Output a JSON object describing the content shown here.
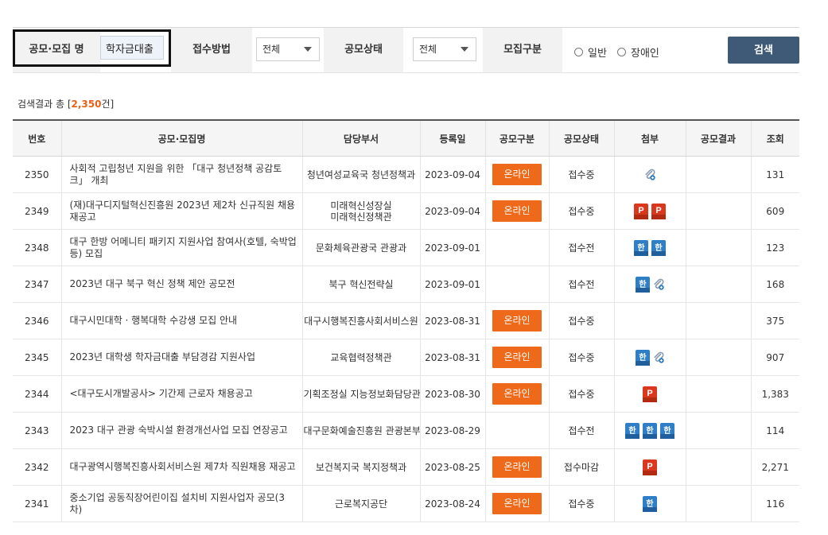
{
  "filter": {
    "title_label": "공모·모집 명",
    "title_value": "학자금대출",
    "method_label": "접수방법",
    "method_value": "전체",
    "status_label": "공모상태",
    "status_value": "전체",
    "category_label": "모집구분",
    "radio_general": "일반",
    "radio_disabled": "장애인",
    "search_button": "검색"
  },
  "result": {
    "prefix": "검색결과 총 [",
    "count": "2,350",
    "suffix": "건]"
  },
  "table": {
    "headers": [
      "번호",
      "공모·모집명",
      "담당부서",
      "등록일",
      "공모구분",
      "공모상태",
      "첨부",
      "공모결과",
      "조회"
    ],
    "rows": [
      {
        "no": "2350",
        "title": "사회적 고립청년 지원을 위한 「대구 청년정책 공감토크」 개최",
        "dept1": "청년여성교육국 청년정책과",
        "dept2": "",
        "date": "2023-09-04",
        "type": "온라인",
        "status": "접수중",
        "views": "131"
      },
      {
        "no": "2349",
        "title": "(재)대구디지털혁신진흥원 2023년 제2차 신규직원 채용 재공고",
        "dept1": "미래혁신성장실",
        "dept2": "미래혁신정책관",
        "date": "2023-09-04",
        "type": "온라인",
        "status": "접수중",
        "views": "609"
      },
      {
        "no": "2348",
        "title": "대구 한방 어메니티 패키지 지원사업 참여사(호텔, 숙박업 등) 모집",
        "dept1": "문화체육관광국 관광과",
        "dept2": "",
        "date": "2023-09-01",
        "type": "",
        "status": "접수전",
        "views": "123"
      },
      {
        "no": "2347",
        "title": "2023년 대구 북구 혁신 정책 제안 공모전",
        "dept1": "북구 혁신전략실",
        "dept2": "",
        "date": "2023-09-01",
        "type": "",
        "status": "접수전",
        "views": "168"
      },
      {
        "no": "2346",
        "title": "대구시민대학 · 행복대학 수강생 모집 안내",
        "dept1": "대구시행복진흥사회서비스원",
        "dept2": "",
        "date": "2023-08-31",
        "type": "온라인",
        "status": "접수중",
        "views": "375"
      },
      {
        "no": "2345",
        "title": "2023년 대학생 학자금대출 부담경감 지원사업",
        "dept1": "교육협력정책관",
        "dept2": "",
        "date": "2023-08-31",
        "type": "온라인",
        "status": "접수중",
        "views": "907"
      },
      {
        "no": "2344",
        "title": "<대구도시개발공사> 기간제 근로자 채용공고",
        "dept1": "기획조정실 지능정보화담당관",
        "dept2": "",
        "date": "2023-08-30",
        "type": "온라인",
        "status": "접수중",
        "views": "1,383"
      },
      {
        "no": "2343",
        "title": "2023 대구 관광 숙박시설 환경개선사업 모집 연장공고",
        "dept1": "대구문화예술진흥원 관광본부",
        "dept2": "",
        "date": "2023-08-29",
        "type": "",
        "status": "접수전",
        "views": "114"
      },
      {
        "no": "2342",
        "title": "대구광역시행복진흥사회서비스원 제7차 직원채용 재공고",
        "dept1": "보건복지국 복지정책과",
        "dept2": "",
        "date": "2023-08-25",
        "type": "온라인",
        "status": "접수마감",
        "views": "2,271"
      },
      {
        "no": "2341",
        "title": "중소기업 공동직장어린이집 설치비 지원사업자 공모(3차)",
        "dept1": "근로복지공단",
        "dept2": "",
        "date": "2023-08-24",
        "type": "온라인",
        "status": "접수중",
        "views": "116"
      }
    ]
  },
  "attachments": [
    [
      "clip-icon"
    ],
    [
      "ppt-file-icon",
      "ppt-file-icon"
    ],
    [
      "hwp-file-icon",
      "hwp-file-icon"
    ],
    [
      "hwp-file-icon",
      "clip-icon"
    ],
    [],
    [
      "hwp-file-icon",
      "clip-icon"
    ],
    [
      "ppt-file-icon"
    ],
    [
      "hwp-file-icon",
      "hwp-file-icon",
      "hwp-file-icon"
    ],
    [
      "ppt-file-icon"
    ],
    [
      "hwp-file-icon"
    ]
  ],
  "colors": {
    "badge": "#ee6a1a",
    "status_open": "#2a8ac6",
    "search_button": "#3e5a77",
    "result_count": "#e8601c"
  }
}
